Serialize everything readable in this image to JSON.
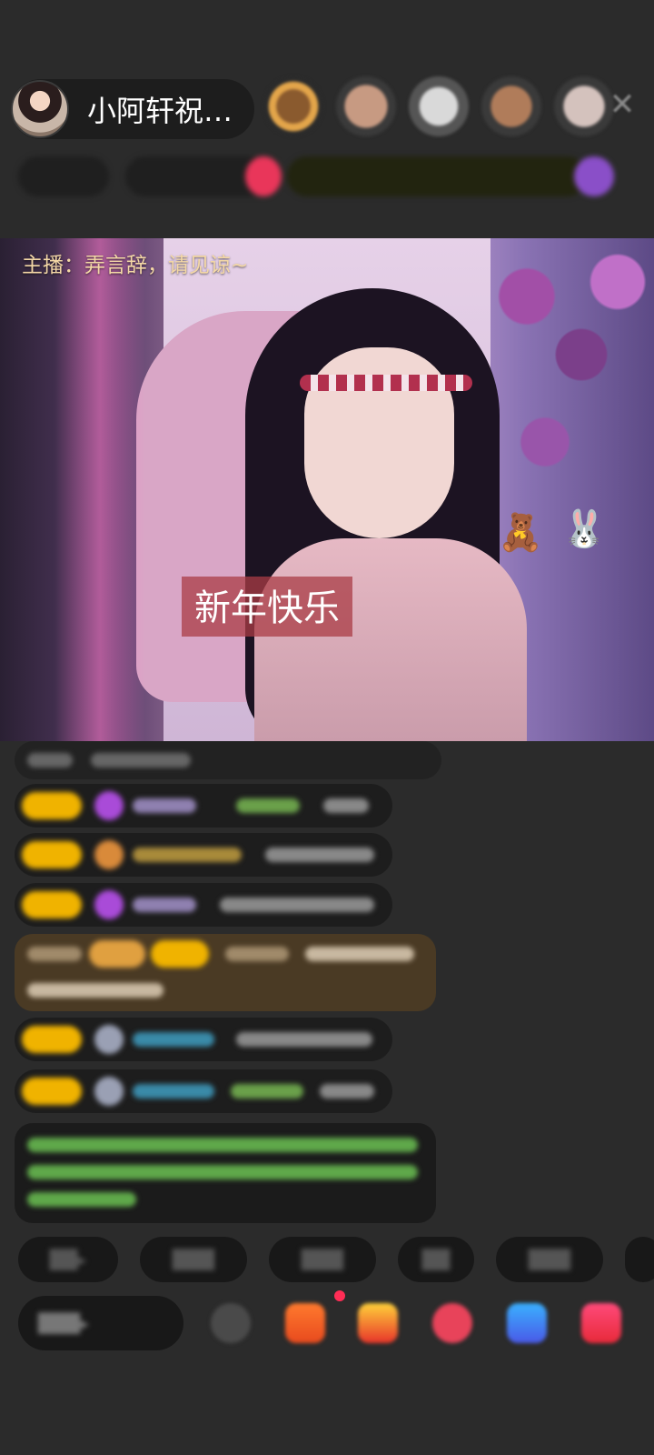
{
  "header": {
    "host_name": "小阿轩祝…",
    "close_icon": "close-icon",
    "viewer_colors": [
      "#9c6b3a",
      "#b78c72",
      "#c7c7c7",
      "#a77b60",
      "#c8b6b0"
    ]
  },
  "video": {
    "host_notice": "主播：弄言辞，请见谅~",
    "sticker_text": "新年快乐"
  },
  "colors": {
    "badge": "#f0b300",
    "accent_pink": "#ff2d55"
  }
}
